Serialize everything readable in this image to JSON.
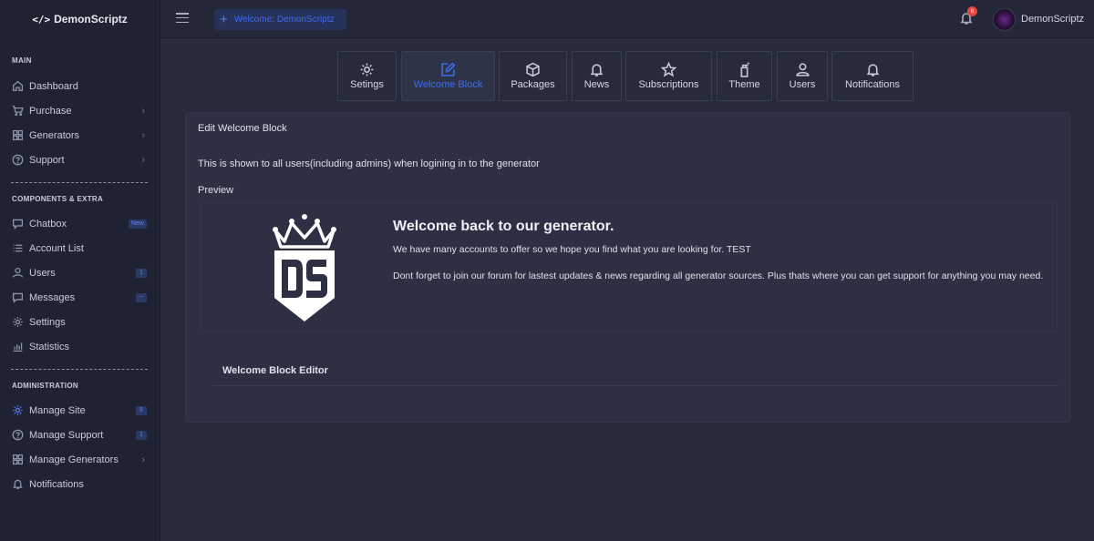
{
  "brand": {
    "name": "DemonScriptz",
    "icon": "code-icon"
  },
  "sidebar": {
    "sections": {
      "main": "MAIN",
      "components": "COMPONENTS & EXTRA",
      "admin": "ADMINISTRATION"
    },
    "main_items": [
      {
        "label": "Dashboard",
        "icon": "home-icon"
      },
      {
        "label": "Purchase",
        "icon": "cart-icon"
      },
      {
        "label": "Generators",
        "icon": "grid-icon"
      },
      {
        "label": "Support",
        "icon": "help-icon"
      }
    ],
    "components_items": [
      {
        "label": "Chatbox",
        "icon": "chat-icon",
        "badge": "New"
      },
      {
        "label": "Account List",
        "icon": "list-icon"
      },
      {
        "label": "Users",
        "icon": "user-icon",
        "badge": "1"
      },
      {
        "label": "Messages",
        "icon": "message-icon",
        "badge": "--"
      },
      {
        "label": "Settings",
        "icon": "gear-icon"
      },
      {
        "label": "Statistics",
        "icon": "bar-chart-icon"
      }
    ],
    "admin_items": [
      {
        "label": "Manage Site",
        "icon": "gear-icon",
        "badge": "8"
      },
      {
        "label": "Manage Support",
        "icon": "help-icon",
        "badge": "1"
      },
      {
        "label": "Manage Generators",
        "icon": "grid-icon"
      },
      {
        "label": "Notifications",
        "icon": "bell-icon"
      }
    ]
  },
  "topbar": {
    "welcome_pill": "Welcome: DemonScriptz",
    "notification_count": "6",
    "username": "DemonScriptz"
  },
  "tabs": [
    {
      "label": "Setings",
      "icon": "gear-icon"
    },
    {
      "label": "Welcome Block",
      "icon": "edit-icon",
      "active": true
    },
    {
      "label": "Packages",
      "icon": "box-icon"
    },
    {
      "label": "News",
      "icon": "bell-icon"
    },
    {
      "label": "Subscriptions",
      "icon": "star-icon"
    },
    {
      "label": "Theme",
      "icon": "spray-can-icon"
    },
    {
      "label": "Users",
      "icon": "user-icon"
    },
    {
      "label": "Notifications",
      "icon": "bell-icon"
    }
  ],
  "card": {
    "title": "Edit Welcome Block",
    "description": "This is shown to all users(including admins) when logining in to the generator",
    "preview_label": "Preview",
    "preview": {
      "logo_text": "DS",
      "heading": "Welcome back to our generator.",
      "line1": "We have many accounts to offer so we hope you find what you are looking for. TEST",
      "line2": "Dont forget to join our forum for lastest updates & news regarding all generator sources. Plus thats where you can get support for anything you may need."
    },
    "editor_title": "Welcome Block Editor"
  },
  "colors": {
    "accent": "#3c6cf0",
    "background": "#262a3b",
    "sidebar": "#1f2233",
    "card": "#2c3042",
    "badge": "#e2463f"
  }
}
